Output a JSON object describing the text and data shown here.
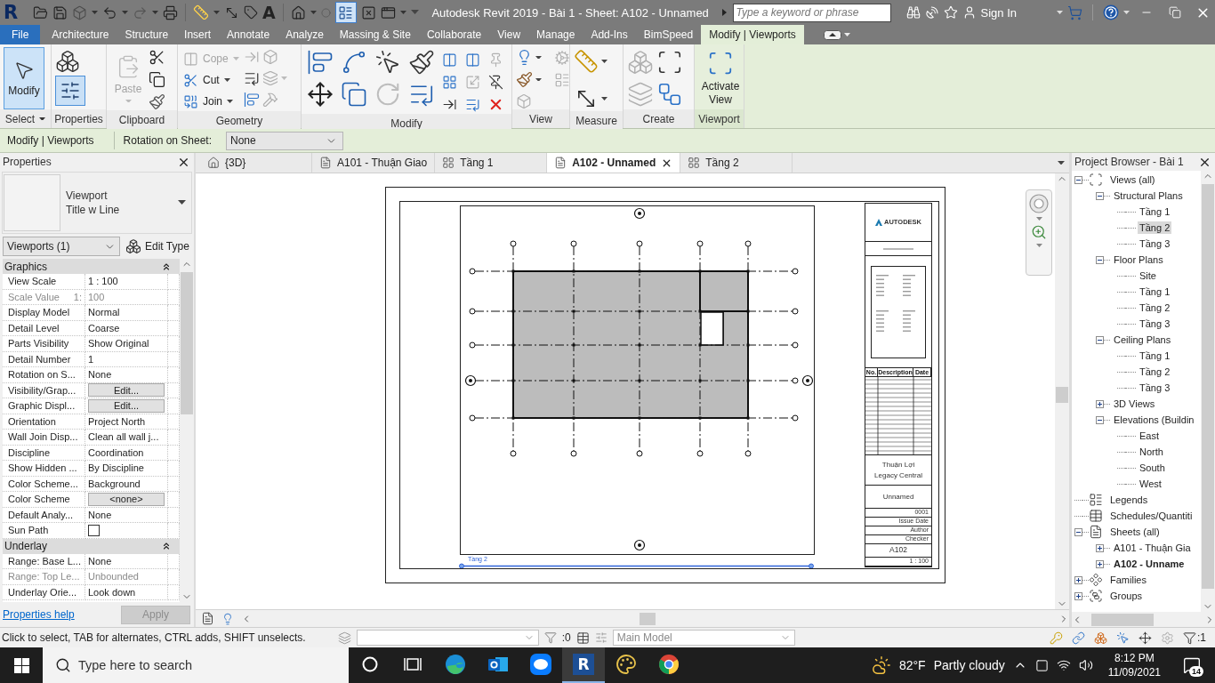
{
  "title_bar": {
    "app_logo": "R",
    "text_tool": "A",
    "title": "Autodesk Revit 2019 - Bài 1 - Sheet: A102 - Unnamed",
    "search": {
      "placeholder": "Type a keyword or phrase"
    },
    "sign_in": "Sign In"
  },
  "ribbon": {
    "tabs": [
      {
        "label": "File",
        "kind": "file",
        "selected": false
      },
      {
        "label": "Architecture",
        "kind": "tab",
        "selected": false
      },
      {
        "label": "Structure",
        "kind": "tab",
        "selected": false
      },
      {
        "label": "Insert",
        "kind": "tab",
        "selected": false
      },
      {
        "label": "Annotate",
        "kind": "tab",
        "selected": false
      },
      {
        "label": "Analyze",
        "kind": "tab",
        "selected": false
      },
      {
        "label": "Massing & Site",
        "kind": "tab",
        "selected": false
      },
      {
        "label": "Collaborate",
        "kind": "tab",
        "selected": false
      },
      {
        "label": "View",
        "kind": "tab",
        "selected": false
      },
      {
        "label": "Manage",
        "kind": "tab",
        "selected": false
      },
      {
        "label": "Add-Ins",
        "kind": "tab",
        "selected": false
      },
      {
        "label": "BimSpeed",
        "kind": "tab",
        "selected": false
      },
      {
        "label": "Modify | Viewports",
        "kind": "contextual",
        "selected": true
      }
    ],
    "panels": [
      {
        "title": "Select",
        "kind": "standard",
        "dropdown": true,
        "buttons": [
          {
            "label": "Modify",
            "selected": true,
            "disabled": false
          }
        ]
      },
      {
        "title": "Properties",
        "kind": "standard",
        "dropdown": false,
        "toggle": {
          "selected": true
        }
      },
      {
        "title": "Clipboard",
        "kind": "standard",
        "dropdown": false,
        "buttons": [
          {
            "label": "Paste",
            "disabled": true
          }
        ]
      },
      {
        "title": "Geometry",
        "kind": "standard",
        "dropdown": false,
        "buttons": [
          {
            "label": "Cope",
            "disabled": true
          },
          {
            "label": "Cut",
            "disabled": false
          },
          {
            "label": "Join",
            "disabled": false
          }
        ]
      },
      {
        "title": "Modify",
        "kind": "standard",
        "dropdown": false
      },
      {
        "title": "View",
        "kind": "standard",
        "dropdown": false
      },
      {
        "title": "Measure",
        "kind": "standard",
        "dropdown": false
      },
      {
        "title": "Create",
        "kind": "standard",
        "dropdown": false
      },
      {
        "title": "Viewport",
        "kind": "contextual",
        "dropdown": false,
        "buttons": [
          {
            "label": "Activate View",
            "disabled": false
          }
        ]
      }
    ]
  },
  "options_bar": {
    "context": "Modify | Viewports",
    "rotation_label": "Rotation on Sheet:",
    "rotation_value": "None"
  },
  "properties": {
    "title": "Properties",
    "type_selector": {
      "family": "Viewport",
      "type": "Title w Line"
    },
    "filter": "Viewports (1)",
    "edit_type": "Edit Type",
    "groups": [
      {
        "title": "Graphics",
        "expanded": true,
        "rows": [
          {
            "name": "View Scale",
            "value": "1 : 100",
            "kind": "text",
            "disabled": false
          },
          {
            "name": "Scale Value",
            "unit": "1:",
            "value": "100",
            "kind": "text",
            "disabled": true
          },
          {
            "name": "Display Model",
            "value": "Normal",
            "kind": "text",
            "disabled": false
          },
          {
            "name": "Detail Level",
            "value": "Coarse",
            "kind": "text",
            "disabled": false
          },
          {
            "name": "Parts Visibility",
            "value": "Show Original",
            "kind": "text",
            "disabled": false
          },
          {
            "name": "Detail Number",
            "value": "1",
            "kind": "text",
            "disabled": false
          },
          {
            "name": "Rotation on S...",
            "value": "None",
            "kind": "text",
            "disabled": false
          },
          {
            "name": "Visibility/Grap...",
            "value": "Edit...",
            "kind": "button",
            "disabled": false
          },
          {
            "name": "Graphic Displ...",
            "value": "Edit...",
            "kind": "button",
            "disabled": false
          },
          {
            "name": "Orientation",
            "value": "Project North",
            "kind": "text",
            "disabled": false
          },
          {
            "name": "Wall Join Disp...",
            "value": "Clean all wall j...",
            "kind": "text",
            "disabled": false
          },
          {
            "name": "Discipline",
            "value": "Coordination",
            "kind": "text",
            "disabled": false
          },
          {
            "name": "Show Hidden ...",
            "value": "By Discipline",
            "kind": "text",
            "disabled": false
          },
          {
            "name": "Color Scheme...",
            "value": "Background",
            "kind": "text",
            "disabled": false
          },
          {
            "name": "Color Scheme",
            "value": "<none>",
            "kind": "button",
            "disabled": false
          },
          {
            "name": "Default Analy...",
            "value": "None",
            "kind": "text",
            "disabled": false
          },
          {
            "name": "Sun Path",
            "kind": "checkbox",
            "checked": false,
            "disabled": false
          }
        ]
      },
      {
        "title": "Underlay",
        "expanded": true,
        "rows": [
          {
            "name": "Range: Base L...",
            "value": "None",
            "kind": "text",
            "disabled": false
          },
          {
            "name": "Range: Top Le...",
            "value": "Unbounded",
            "kind": "text",
            "disabled": true
          },
          {
            "name": "Underlay Orie...",
            "value": "Look down",
            "kind": "text",
            "disabled": false
          }
        ]
      }
    ],
    "help_link": "Properties help",
    "apply": {
      "label": "Apply",
      "disabled": true
    }
  },
  "canvas": {
    "tabs": [
      {
        "label": "{3D}",
        "kind": "model",
        "selected": false
      },
      {
        "label": "A101 - Thuận Giao",
        "kind": "sheet",
        "selected": false
      },
      {
        "label": "Tầng 1",
        "kind": "plan",
        "selected": false
      },
      {
        "label": "A102 - Unnamed",
        "kind": "sheet",
        "selected": true
      },
      {
        "label": "Tầng 2",
        "kind": "plan",
        "selected": false
      }
    ],
    "sheet": {
      "viewport": {
        "title": "Tầng 2",
        "selected": true
      },
      "title_block": {
        "logo": "AUTODESK",
        "revision_columns": [
          "No.",
          "Description",
          "Date"
        ],
        "project": "Thuận Lợi",
        "project_subtitle": "Legacy Central",
        "sheet_name": "Unnamed",
        "fields": [
          "0001",
          "Issue Date",
          "Author",
          "Checker"
        ],
        "sheet_number": "A102",
        "scale": "1 : 100"
      }
    }
  },
  "project_browser": {
    "title": "Project Browser - Bài 1",
    "tree": [
      {
        "label": "Views (all)",
        "kind": "views",
        "expanded": true,
        "selected": false,
        "children": [
          {
            "label": "Structural Plans",
            "expanded": true,
            "selected": false,
            "children": [
              {
                "label": "Tầng 1",
                "selected": false
              },
              {
                "label": "Tầng 2",
                "selected": true
              },
              {
                "label": "Tầng 3",
                "selected": false
              }
            ]
          },
          {
            "label": "Floor Plans",
            "expanded": true,
            "selected": false,
            "children": [
              {
                "label": "Site",
                "selected": false
              },
              {
                "label": "Tầng 1",
                "selected": false
              },
              {
                "label": "Tầng 2",
                "selected": false
              },
              {
                "label": "Tầng 3",
                "selected": false
              }
            ]
          },
          {
            "label": "Ceiling Plans",
            "expanded": true,
            "selected": false,
            "children": [
              {
                "label": "Tầng 1",
                "selected": false
              },
              {
                "label": "Tầng 2",
                "selected": false
              },
              {
                "label": "Tầng 3",
                "selected": false
              }
            ]
          },
          {
            "label": "3D Views",
            "expanded": false,
            "selected": false
          },
          {
            "label": "Elevations (Buildin",
            "expanded": true,
            "selected": false,
            "children": [
              {
                "label": "East",
                "selected": false
              },
              {
                "label": "North",
                "selected": false
              },
              {
                "label": "South",
                "selected": false
              },
              {
                "label": "West",
                "selected": false
              }
            ]
          }
        ]
      },
      {
        "label": "Legends",
        "kind": "legends",
        "selected": false
      },
      {
        "label": "Schedules/Quantiti",
        "kind": "schedules",
        "selected": false
      },
      {
        "label": "Sheets (all)",
        "kind": "sheets",
        "expanded": true,
        "selected": false,
        "children": [
          {
            "label": "A101 - Thuận Gia",
            "expanded": false,
            "selected": false,
            "active": false
          },
          {
            "label": "A102 - Unname",
            "expanded": false,
            "selected": false,
            "active": true
          }
        ]
      },
      {
        "label": "Families",
        "kind": "families",
        "expanded": false,
        "selected": false
      },
      {
        "label": "Groups",
        "kind": "groups",
        "expanded": false,
        "selected": false
      }
    ]
  },
  "status_bar": {
    "message": "Click to select, TAB for alternates, CTRL adds, SHIFT unselects.",
    "editable_count": ":0",
    "workset": {
      "value": "Main Model",
      "disabled": true
    },
    "filter_count": ":1"
  },
  "taskbar": {
    "search_placeholder": "Type here to search",
    "apps": [
      {
        "kind": "edge",
        "selected": false
      },
      {
        "kind": "mail",
        "selected": false
      },
      {
        "kind": "chat",
        "selected": false
      },
      {
        "kind": "revit",
        "glyph": "R",
        "selected": true
      },
      {
        "kind": "paint",
        "selected": false
      },
      {
        "kind": "chrome",
        "selected": false
      }
    ],
    "weather": {
      "temperature": "82°F",
      "condition": "Partly cloudy"
    },
    "clock": {
      "time": "8:12 PM",
      "date": "11/09/2021"
    },
    "notifications": "14"
  }
}
